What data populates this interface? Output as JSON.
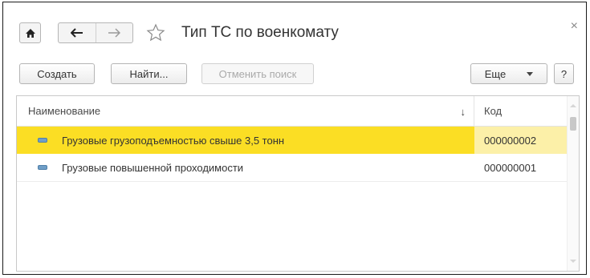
{
  "header": {
    "title": "Тип ТС по военкомату",
    "home_icon": "home-icon",
    "back_icon": "arrow-left-icon",
    "forward_icon": "arrow-right-icon",
    "favorite_icon": "star-outline-icon",
    "close_label": "×"
  },
  "toolbar": {
    "create_label": "Создать",
    "find_label": "Найти...",
    "cancel_search_label": "Отменить поиск",
    "more_label": "Еще",
    "help_label": "?"
  },
  "table": {
    "columns": {
      "name": "Наименование",
      "code": "Код"
    },
    "sort_indicator": "↓",
    "rows": [
      {
        "name": "Грузовые грузоподъемностью свыше 3,5 тонн",
        "code": "000000002",
        "selected": true
      },
      {
        "name": "Грузовые повышенной проходимости",
        "code": "000000001",
        "selected": false
      }
    ]
  },
  "colors": {
    "selected_row": "#fbde24",
    "selected_code_cell": "#fcf0a8",
    "item_icon": "#6f9ec7"
  }
}
